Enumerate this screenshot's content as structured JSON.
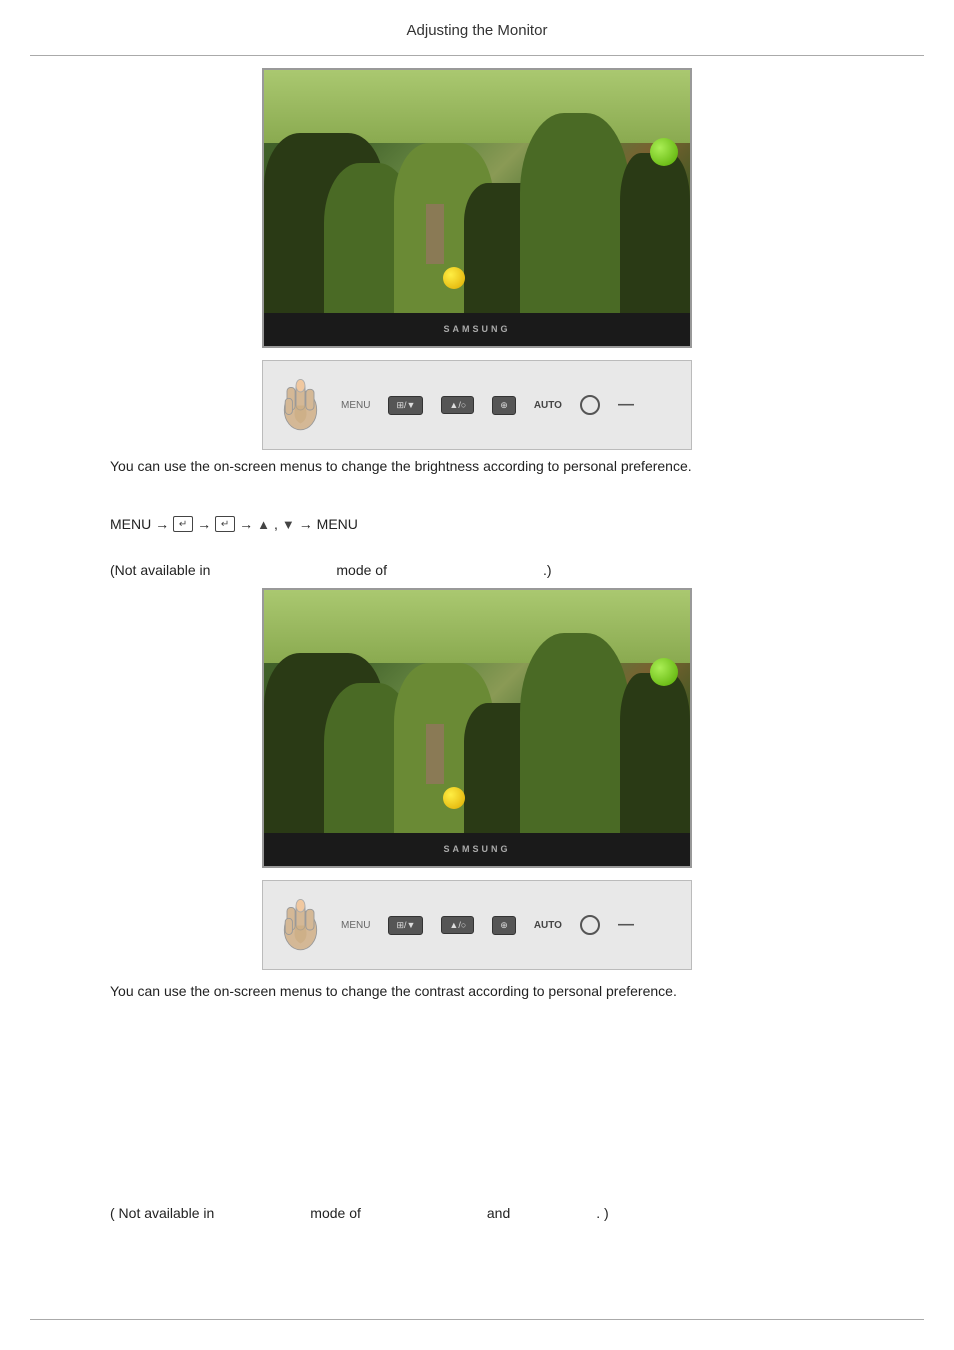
{
  "page": {
    "title": "Adjusting the Monitor",
    "desc1": "You can use the on-screen menus to change the brightness according to personal preference.",
    "desc2": "You can use the on-screen menus to change the contrast according to personal preference.",
    "menu_nav": "MENU → → → ▲ , ▼ → MENU",
    "not_available_1_prefix": "(Not available in",
    "not_available_1_middle": "mode of",
    "not_available_1_suffix": ".)",
    "not_available_2_prefix": "( Not available in",
    "not_available_2_middle": "mode of",
    "not_available_2_and": "and",
    "not_available_2_suffix": ". )",
    "samsung_logo": "SAMSUNG",
    "ctrl_buttons": {
      "btn1": "⊞/▼",
      "btn2": "▲/○",
      "btn3": "⊕",
      "btn4": "AUTO"
    }
  }
}
